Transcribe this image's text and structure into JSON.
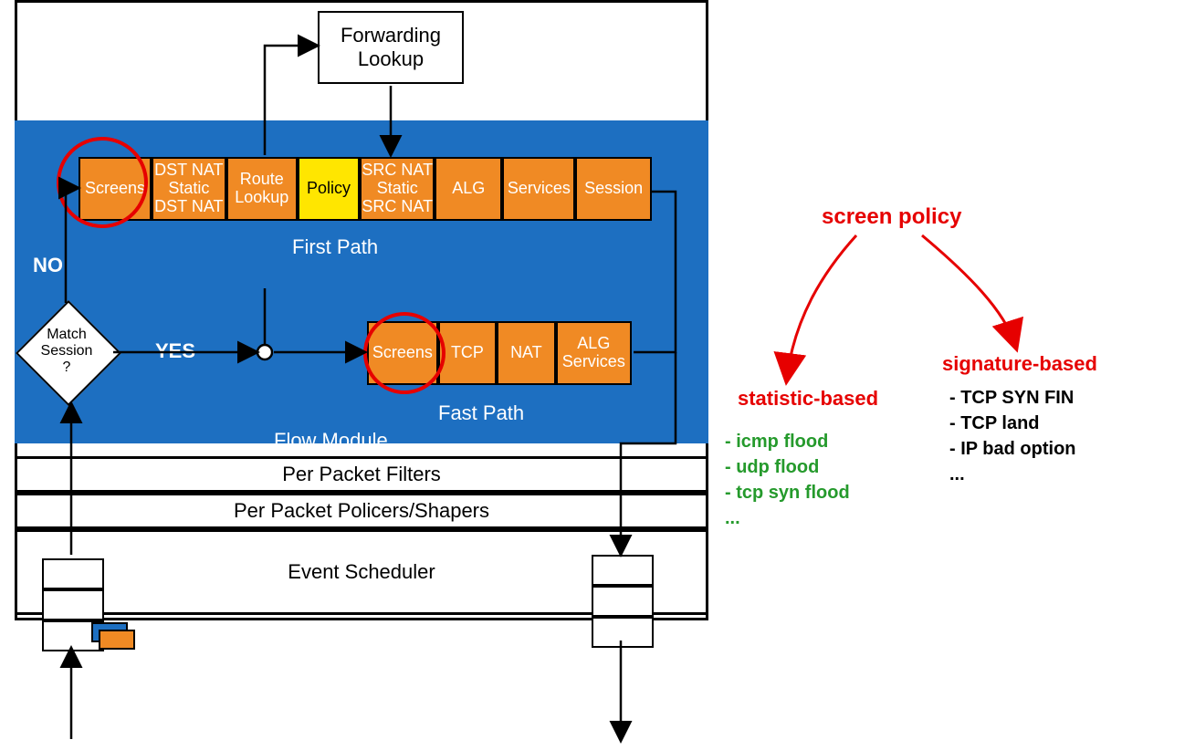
{
  "diagram": {
    "forwarding": "Forwarding\nLookup",
    "decision": "Match\nSession\n?",
    "no": "NO",
    "yes": "YES",
    "firstPathLabel": "First Path",
    "fastPathLabel": "Fast Path",
    "flowModuleLabel": "Flow Module",
    "firstPath": {
      "screens": "Screens",
      "dstnat": "DST NAT\nStatic\nDST NAT",
      "route": "Route\nLookup",
      "policy": "Policy",
      "srcnat": "SRC NAT\nStatic\nSRC NAT",
      "alg": "ALG",
      "services": "Services",
      "session": "Session"
    },
    "fastPath": {
      "screens": "Screens",
      "tcp": "TCP",
      "nat": "NAT",
      "algsvc": "ALG\nServices"
    },
    "bars": {
      "filters": "Per Packet Filters",
      "policers": "Per Packet Policers/Shapers",
      "scheduler": "Event Scheduler"
    }
  },
  "annotations": {
    "title": "screen policy",
    "statistic": {
      "title": "statistic-based",
      "items": [
        "- icmp flood",
        "- udp flood",
        "- tcp syn flood",
        "  ..."
      ]
    },
    "signature": {
      "title": "signature-based",
      "items": [
        "- TCP SYN FIN",
        "- TCP land",
        "- IP bad option",
        "     ..."
      ]
    }
  }
}
